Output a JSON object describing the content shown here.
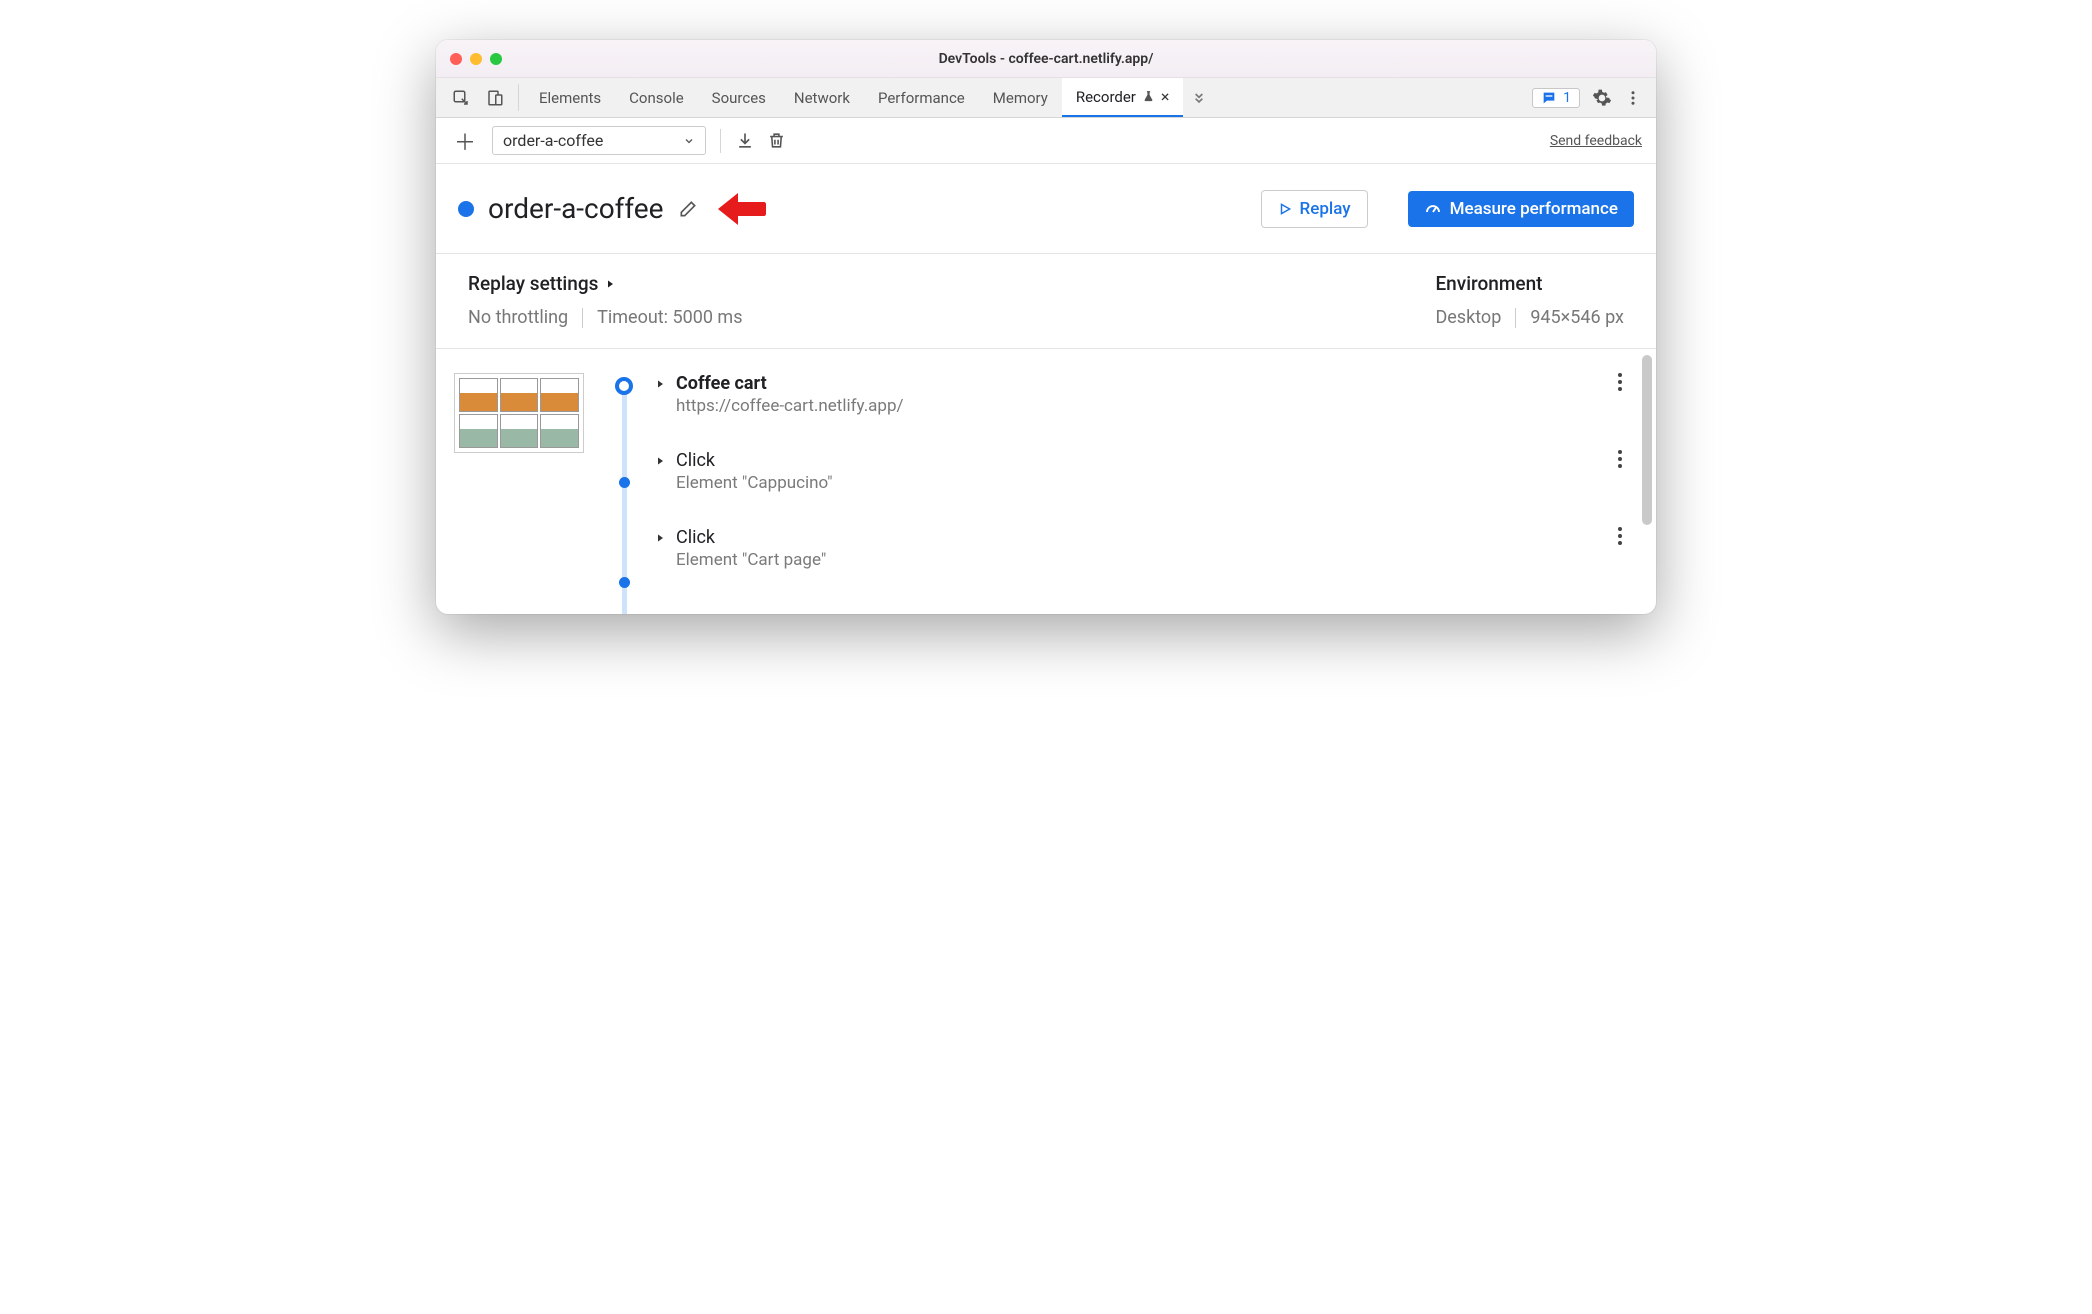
{
  "window": {
    "title": "DevTools - coffee-cart.netlify.app/"
  },
  "tabs": {
    "items": [
      "Elements",
      "Console",
      "Sources",
      "Network",
      "Performance",
      "Memory",
      "Recorder"
    ],
    "active": "Recorder",
    "issuesCount": "1"
  },
  "toolbar": {
    "recordingName": "order-a-coffee",
    "feedbackLink": "Send feedback"
  },
  "header": {
    "title": "order-a-coffee",
    "replayLabel": "Replay",
    "measureLabel": "Measure performance"
  },
  "settings": {
    "title": "Replay settings",
    "throttling": "No throttling",
    "timeout": "Timeout: 5000 ms",
    "envTitle": "Environment",
    "device": "Desktop",
    "viewport": "945×546 px"
  },
  "steps": [
    {
      "title": "Coffee cart",
      "sub": "https://coffee-cart.netlify.app/",
      "bold": true,
      "first": true
    },
    {
      "title": "Click",
      "sub": "Element \"Cappucino\""
    },
    {
      "title": "Click",
      "sub": "Element \"Cart page\""
    }
  ]
}
